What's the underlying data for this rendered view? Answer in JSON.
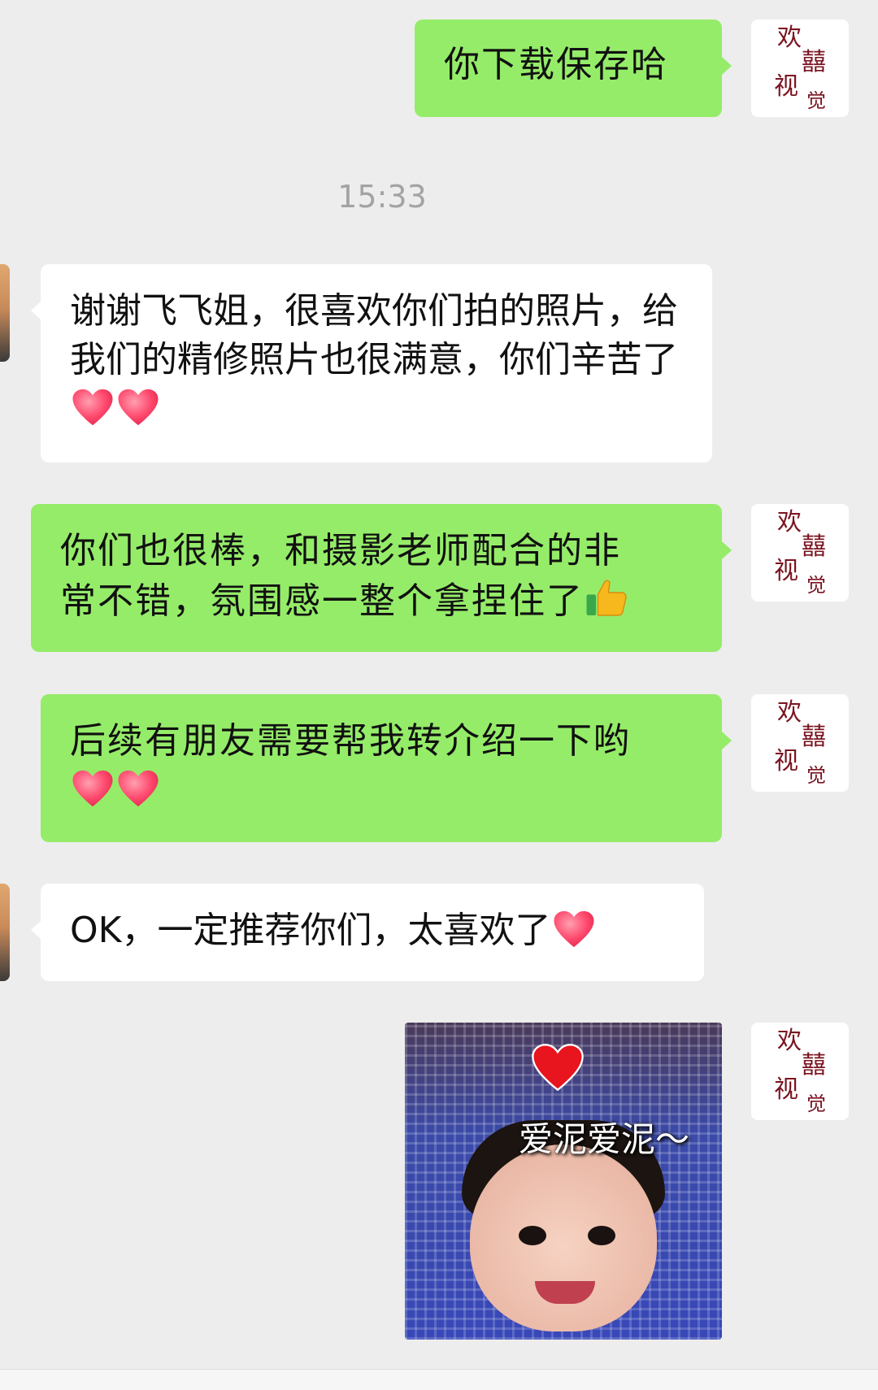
{
  "messages": [
    {
      "side": "self",
      "text": "你下载保存哈"
    },
    {
      "side": "peer",
      "text": "谢谢飞飞姐，很喜欢你们拍的照片，给我们的精修照片也很满意，你们辛苦了",
      "emoji": [
        "heart",
        "heart"
      ]
    },
    {
      "side": "self",
      "text_line1": "你们也很棒，和摄影老师配合的非",
      "text_line2": "常不错，氛围感一整个拿捏住了",
      "emoji": [
        "thumbs-up"
      ]
    },
    {
      "side": "self",
      "text": "后续有朋友需要帮我转介绍一下哟",
      "emoji": [
        "heart",
        "heart"
      ]
    },
    {
      "side": "peer",
      "text": "OK，一定推荐你们，太喜欢了",
      "emoji": [
        "heart"
      ]
    },
    {
      "side": "self",
      "type": "sticker",
      "caption": "爱泥爱泥～"
    }
  ],
  "timestamp": "15:33",
  "self_avatar": {
    "logo_text": "欢囍视觉"
  },
  "colors": {
    "self_bubble": "#95ec69",
    "peer_bubble": "#ffffff",
    "background": "#ededed",
    "timestamp": "#a3a3a3"
  },
  "icons": {
    "heart": "heart-emoji-icon",
    "thumb": "thumbs-up-emoji-icon"
  }
}
